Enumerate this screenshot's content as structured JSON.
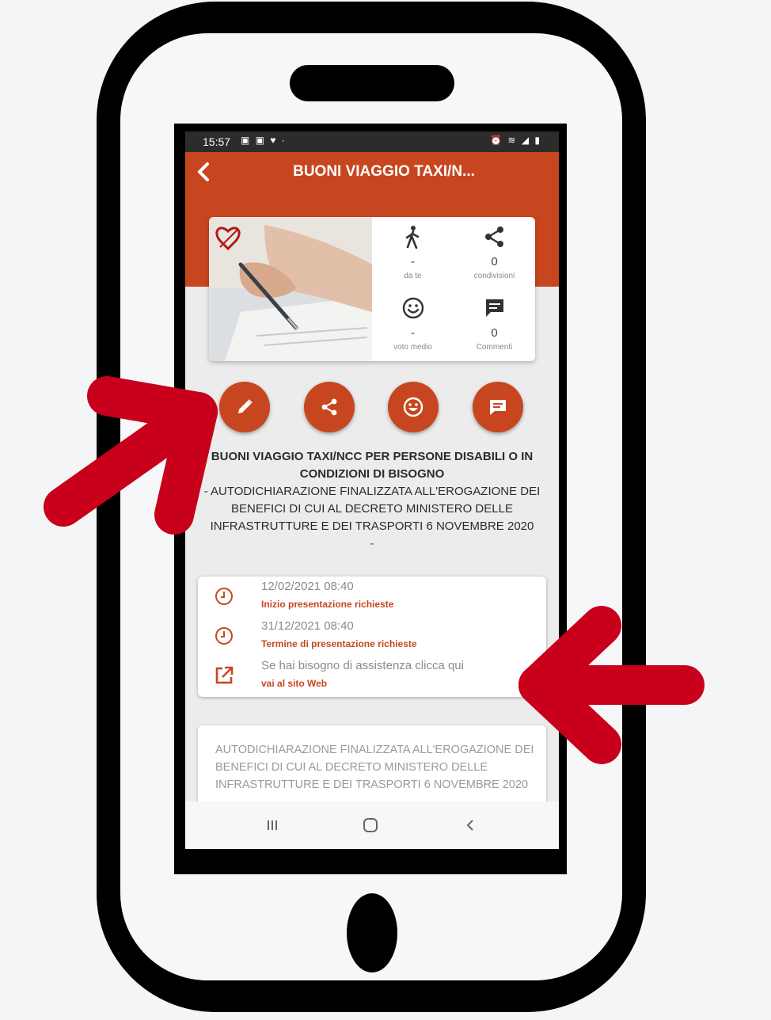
{
  "status_bar": {
    "time": "15:57",
    "left_icons": "▣ ▣ ♥ ·",
    "right_icons": "⏰ ≋ ◢ ▮"
  },
  "app_bar": {
    "title": "BUONI VIAGGIO TAXI/N...",
    "back_icon": "chevron-left-icon"
  },
  "stats": {
    "da_te_value": "-",
    "da_te_label": "da te",
    "condivisioni_value": "0",
    "condivisioni_label": "condivisioni",
    "voto_value": "-",
    "voto_label": "voto medio",
    "commenti_value": "0",
    "commenti_label": "Commenti"
  },
  "actions": {
    "edit_icon": "pencil-icon",
    "share_icon": "share-icon",
    "rate_icon": "smiley-icon",
    "comment_icon": "comment-icon"
  },
  "service": {
    "title": "BUONI VIAGGIO TAXI/NCC PER PERSONE DISABILI O IN CONDIZIONI DI BISOGNO",
    "subtitle": "- AUTODICHIARAZIONE FINALIZZATA ALL'EROGAZIONE DEI BENEFICI DI CUI AL DECRETO MINISTERO DELLE INFRASTRUTTURE E DEI TRASPORTI 6 NOVEMBRE 2020",
    "trailing": "-"
  },
  "info": {
    "start_date": "12/02/2021 08:40",
    "start_label": "Inizio presentazione richieste",
    "end_date": "31/12/2021 08:40",
    "end_label": "Termine di presentazione richieste",
    "help_text": "Se hai bisogno di assistenza clicca qui",
    "help_link": "vai al sito Web"
  },
  "description": {
    "text": "AUTODICHIARAZIONE FINALIZZATA ALL'EROGAZIONE DEI BENEFICI DI CUI AL DECRETO MINISTERO DELLE INFRASTRUTTURE E DEI TRASPORTI 6 NOVEMBRE 2020"
  },
  "colors": {
    "brand": "#c8461f",
    "arrow": "#c8001b",
    "frame": "#000000"
  }
}
